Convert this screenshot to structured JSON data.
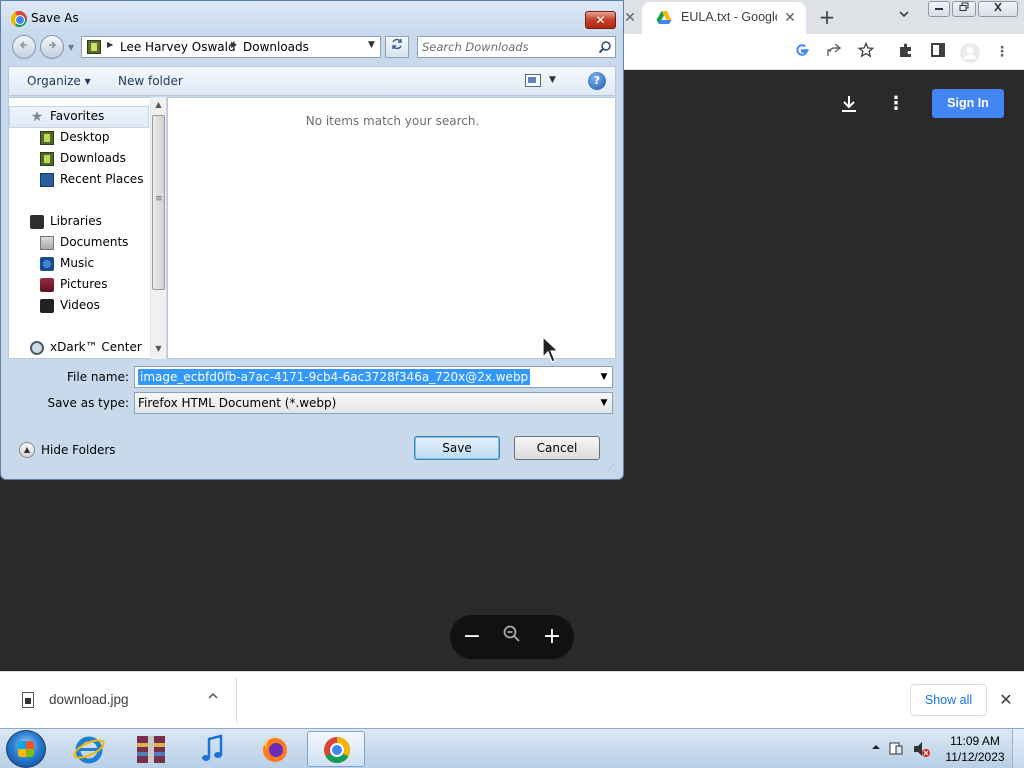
{
  "browser": {
    "tab_title": "EULA.txt - Google Drive",
    "new_tab_symbol": "+",
    "close_symbol": "✕",
    "page": {
      "sign_in_label": "Sign In"
    },
    "zoom_controls": {
      "minus": "−",
      "zoom": "⌕",
      "plus": "+"
    },
    "downloads_bar": {
      "file_name": "download.jpg",
      "show_all_label": "Show all",
      "close_symbol": "✕"
    },
    "icons": [
      "drive-icon",
      "google-icon",
      "share-icon",
      "bookmark-star-icon",
      "extensions-icon",
      "side-panel-icon",
      "profile-icon",
      "menu-icon",
      "download-icon",
      "more-vert-icon"
    ]
  },
  "dialog": {
    "title": "Save As",
    "close_symbol": "✕",
    "address": {
      "segments": [
        "Lee Harvey Oswald",
        "Downloads"
      ]
    },
    "search": {
      "placeholder": "Search Downloads"
    },
    "command_bar": {
      "organize_label": "Organize ▾",
      "new_folder_label": "New folder",
      "help_symbol": "?"
    },
    "nav": {
      "favorites_label": "Favorites",
      "favorites": [
        "Desktop",
        "Downloads",
        "Recent Places"
      ],
      "libraries_label": "Libraries",
      "libraries": [
        "Documents",
        "Music",
        "Pictures",
        "Videos"
      ],
      "other": [
        "xDark™ Center"
      ]
    },
    "empty_message": "No items match your search.",
    "file_name_label": "File name:",
    "file_name_value": "image_ecbfd0fb-a7ac-4171-9cb4-6ac3728f346a_720x@2x.webp",
    "save_type_label": "Save as type:",
    "save_type_value": "Firefox HTML Document (*.webp)",
    "hide_folders_label": "Hide Folders",
    "save_label": "Save",
    "cancel_label": "Cancel"
  },
  "taskbar": {
    "apps": [
      "internet-explorer",
      "winrar",
      "itunes",
      "firefox",
      "chrome"
    ],
    "active_app": "chrome",
    "clock_time": "11:09 AM",
    "clock_date": "11/12/2023"
  },
  "colors": {
    "sign_in_blue": "#4285f4",
    "selection_blue": "#3399ff",
    "page_dark": "#2a2a2a"
  }
}
